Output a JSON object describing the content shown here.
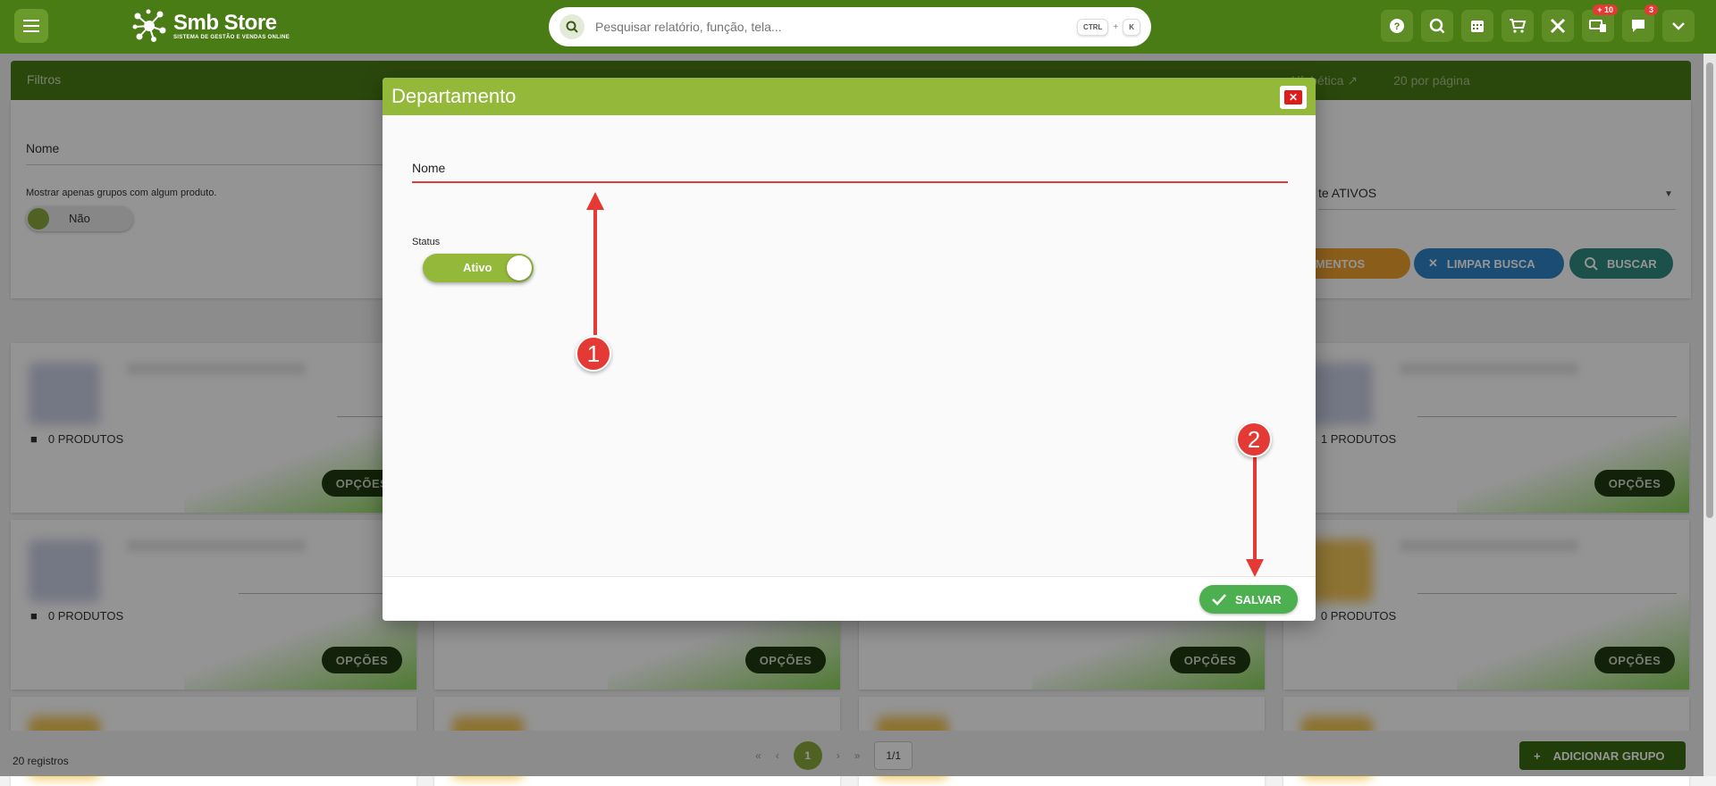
{
  "topbar": {
    "brand_name": "Smb Store",
    "brand_tagline": "SISTEMA DE GESTÃO E VENDAS ONLINE",
    "search_placeholder": "Pesquisar relatório, função, tela...",
    "shortcut_key1": "CTRL",
    "shortcut_plus": "+",
    "shortcut_key2": "K",
    "notifications_badge": "+ 10",
    "messages_badge": "3",
    "icons": [
      "help-icon",
      "zoom-search-icon",
      "calendar-icon",
      "cart-icon",
      "tools-icon",
      "screens-icon",
      "chat-icon",
      "chevron-down-icon"
    ]
  },
  "filters": {
    "title": "Filtros",
    "sort_label": "Alfabética ↗",
    "per_page_label": "20 por página",
    "name_label": "Nome",
    "checkbox_label": "Mostrar apenas grupos com algum produto.",
    "toggle_label": "Não",
    "status_value": "te ATIVOS",
    "buttons": {
      "departments": "RTAMENTOS",
      "clear": "LIMPAR BUSCA",
      "search": "BUSCAR"
    }
  },
  "cards": [
    {
      "products": "0 PRODUTOS",
      "options": "OPÇÕES"
    },
    {
      "products": "1 PRODUTOS",
      "options": "OPÇÕES"
    },
    {
      "products": "0 PRODUTOS",
      "options": "OPÇÕES"
    },
    {
      "products": "0 PRODUTOS",
      "options": "OPÇÕES"
    },
    {
      "options": "OPÇÕES"
    },
    {
      "options": "OPÇÕES"
    }
  ],
  "footer": {
    "records": "20 registros",
    "current_page": "1",
    "page_indicator": "1/1",
    "add_group": "ADICIONAR GRUPO"
  },
  "modal": {
    "title": "Departamento",
    "close_label": "✕",
    "name_label": "Nome",
    "status_label": "Status",
    "status_toggle": "Ativo",
    "save_label": "SALVAR"
  },
  "annotations": {
    "marker1": "1",
    "marker2": "2"
  },
  "colors": {
    "brand_green": "#4a7c16",
    "modal_header": "#93b83a",
    "annotation_red": "#e53935",
    "save_green": "#4caf50"
  }
}
